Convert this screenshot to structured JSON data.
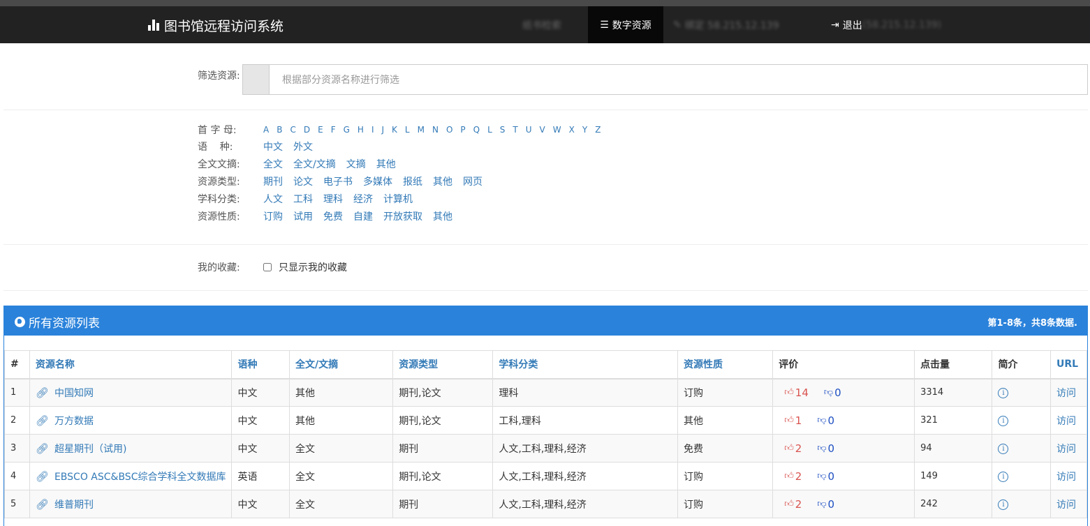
{
  "navbar": {
    "brand": "图书馆远程访问系统",
    "items": [
      {
        "label": "纸书检索",
        "glyph": "",
        "blurred": true
      },
      {
        "label": "数字资源",
        "glyph": "☰",
        "active": true
      },
      {
        "label": "绑定 58.215.12.139",
        "glyph": "✎",
        "blurred": true
      },
      {
        "label": "退出",
        "sub": "(58.215.12.139)",
        "glyph": "⇥"
      }
    ]
  },
  "filter": {
    "label": "筛选资源:",
    "placeholder": "根据部分资源名称进行筛选"
  },
  "facets": {
    "letters_label": "首 字 母:",
    "letters": [
      "A",
      "B",
      "C",
      "D",
      "E",
      "F",
      "G",
      "H",
      "I",
      "J",
      "K",
      "L",
      "M",
      "N",
      "O",
      "P",
      "Q",
      "L",
      "S",
      "T",
      "U",
      "V",
      "W",
      "X",
      "Y",
      "Z"
    ],
    "language": {
      "label": "语    种:",
      "options": [
        "中文",
        "外文"
      ]
    },
    "fulltext": {
      "label": "全文文摘:",
      "options": [
        "全文",
        "全文/文摘",
        "文摘",
        "其他"
      ]
    },
    "restype": {
      "label": "资源类型:",
      "options": [
        "期刊",
        "论文",
        "电子书",
        "多媒体",
        "报纸",
        "其他",
        "网页"
      ]
    },
    "subject": {
      "label": "学科分类:",
      "options": [
        "人文",
        "工科",
        "理科",
        "经济",
        "计算机"
      ]
    },
    "nature": {
      "label": "资源性质:",
      "options": [
        "订购",
        "试用",
        "免费",
        "自建",
        "开放获取",
        "其他"
      ]
    }
  },
  "favorites": {
    "label": "我的收藏:",
    "checkbox_label": "只显示我的收藏",
    "checked": false
  },
  "panel": {
    "title": "所有资源列表",
    "summary": "第1-8条，共8条数据."
  },
  "table": {
    "headers": [
      "#",
      "资源名称",
      "语种",
      "全文/文摘",
      "资源类型",
      "学科分类",
      "资源性质",
      "评价",
      "点击量",
      "简介",
      "URL"
    ],
    "rows": [
      {
        "idx": "1",
        "name": "中国知网",
        "lang": "中文",
        "fulltext": "其他",
        "type": "期刊,论文",
        "subject": "理科",
        "nature": "订购",
        "likes": "14",
        "dislikes": "0",
        "clicks": "3314",
        "url": "访问"
      },
      {
        "idx": "2",
        "name": "万方数据",
        "lang": "中文",
        "fulltext": "其他",
        "type": "期刊,论文",
        "subject": "工科,理科",
        "nature": "其他",
        "likes": "1",
        "dislikes": "0",
        "clicks": "321",
        "url": "访问"
      },
      {
        "idx": "3",
        "name": "超星期刊（试用)",
        "lang": "中文",
        "fulltext": "全文",
        "type": "期刊",
        "subject": "人文,工科,理科,经济",
        "nature": "免费",
        "likes": "2",
        "dislikes": "0",
        "clicks": "94",
        "url": "访问"
      },
      {
        "idx": "4",
        "name": "EBSCO ASC&BSC综合学科全文数据库",
        "lang": "英语",
        "fulltext": "全文",
        "type": "期刊,论文",
        "subject": "人文,工科,理科,经济",
        "nature": "订购",
        "likes": "2",
        "dislikes": "0",
        "clicks": "149",
        "url": "访问"
      },
      {
        "idx": "5",
        "name": "维普期刊",
        "lang": "中文",
        "fulltext": "全文",
        "type": "期刊",
        "subject": "人文,工科,理科,经济",
        "nature": "订购",
        "likes": "2",
        "dislikes": "0",
        "clicks": "242",
        "url": "访问"
      }
    ]
  },
  "colors": {
    "navbar": "#222222",
    "panel": "#2a82db",
    "link": "#337ab7",
    "like": "#d9534f",
    "dislike": "#1e4fc2"
  }
}
